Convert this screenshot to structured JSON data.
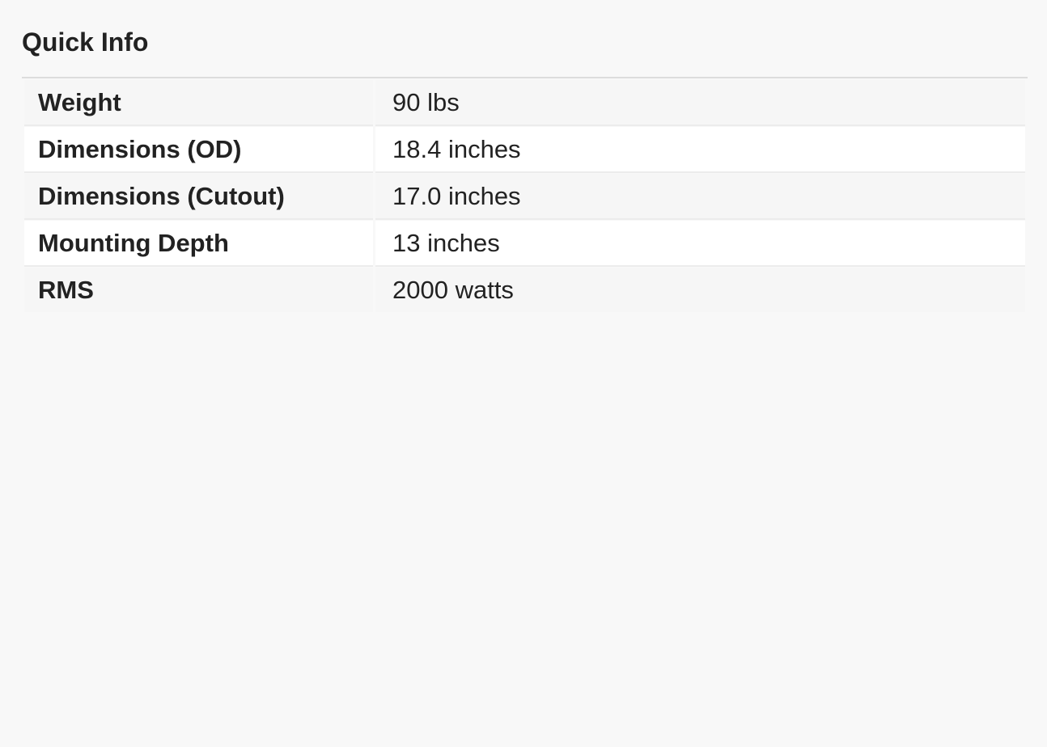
{
  "panel": {
    "title": "Quick Info"
  },
  "specs": [
    {
      "label": "Weight",
      "value": "90 lbs"
    },
    {
      "label": "Dimensions (OD)",
      "value": "18.4 inches"
    },
    {
      "label": "Dimensions (Cutout)",
      "value": "17.0 inches"
    },
    {
      "label": "Mounting Depth",
      "value": "13 inches"
    },
    {
      "label": "RMS",
      "value": "2000 watts"
    }
  ],
  "colors": {
    "background": "#f8f8f8",
    "row_light": "#ffffff",
    "row_shaded": "#f6f6f6",
    "text": "#222222",
    "divider": "#dddddd"
  }
}
